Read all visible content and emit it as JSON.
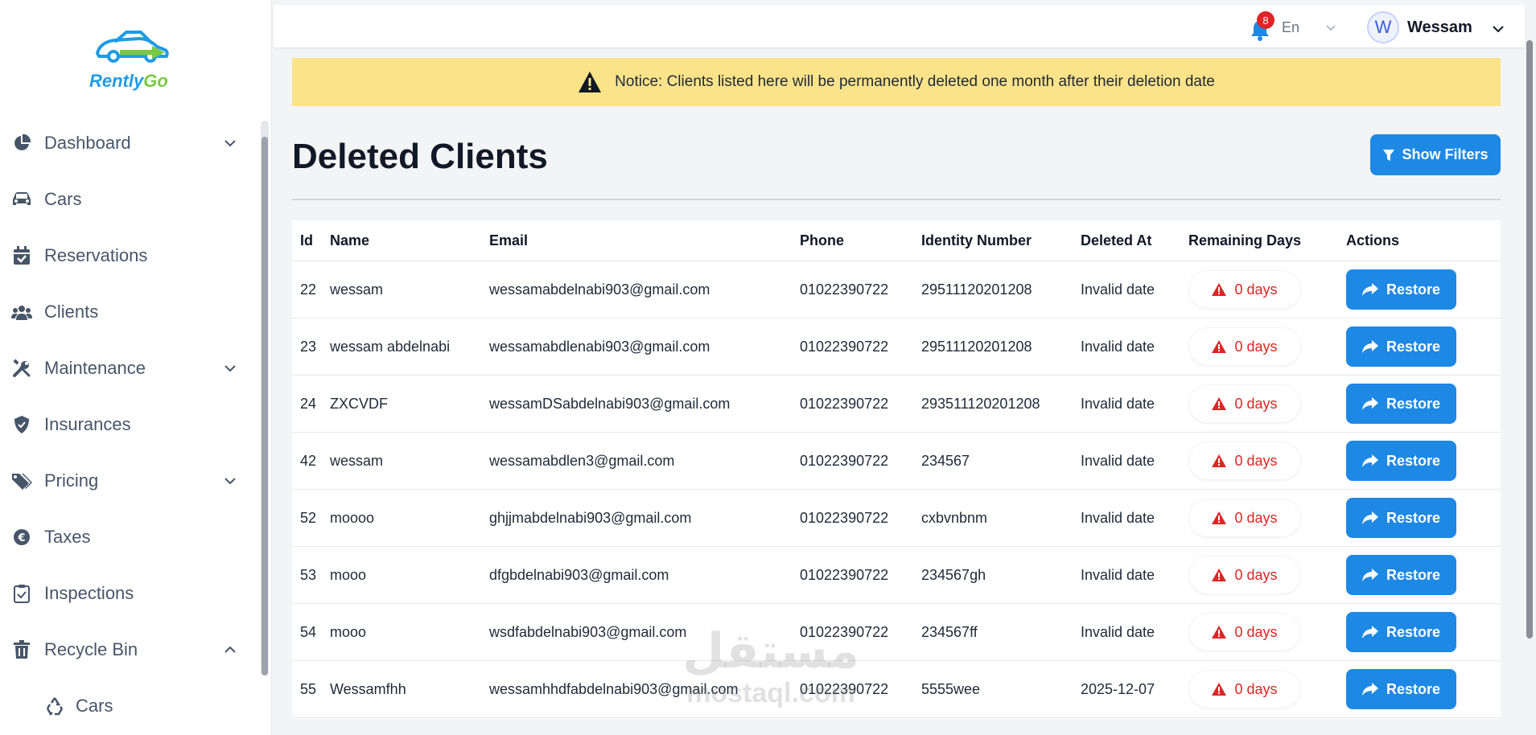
{
  "brand": {
    "name_part1": "Rently",
    "name_part2": "Go",
    "primary_color": "#1e88e5",
    "accent_color": "#7ac943"
  },
  "sidebar": {
    "items": [
      {
        "label": "Dashboard",
        "icon": "pie-chart-icon",
        "expandable": true
      },
      {
        "label": "Cars",
        "icon": "car-icon",
        "expandable": false
      },
      {
        "label": "Reservations",
        "icon": "calendar-check-icon",
        "expandable": false
      },
      {
        "label": "Clients",
        "icon": "users-icon",
        "expandable": false
      },
      {
        "label": "Maintenance",
        "icon": "tools-icon",
        "expandable": true
      },
      {
        "label": "Insurances",
        "icon": "shield-icon",
        "expandable": false
      },
      {
        "label": "Pricing",
        "icon": "tags-icon",
        "expandable": true
      },
      {
        "label": "Taxes",
        "icon": "euro-coin-icon",
        "expandable": false
      },
      {
        "label": "Inspections",
        "icon": "clipboard-check-icon",
        "expandable": false
      },
      {
        "label": "Recycle Bin",
        "icon": "trash-icon",
        "expandable": true,
        "expanded": true
      }
    ],
    "sub_items": [
      {
        "label": "Cars",
        "icon": "recycle-icon"
      }
    ]
  },
  "header": {
    "notification_count": "8",
    "language": "En",
    "user_initial": "W",
    "user_name": "Wessam"
  },
  "notice": {
    "text": "Notice: Clients listed here will be permanently deleted one month after their deletion date"
  },
  "page": {
    "title": "Deleted Clients",
    "filters_label": "Show Filters"
  },
  "table": {
    "columns": [
      "Id",
      "Name",
      "Email",
      "Phone",
      "Identity Number",
      "Deleted At",
      "Remaining Days",
      "Actions"
    ],
    "restore_label": "Restore",
    "rows": [
      {
        "id": "22",
        "name": "wessam",
        "email": "wessamabdelnabi903@gmail.com",
        "phone": "01022390722",
        "identity": "29511120201208",
        "deleted_at": "Invalid date",
        "remaining": "0 days"
      },
      {
        "id": "23",
        "name": "wessam abdelnabi",
        "email": "wessamabdlenabi903@gmail.com",
        "phone": "01022390722",
        "identity": "29511120201208",
        "deleted_at": "Invalid date",
        "remaining": "0 days"
      },
      {
        "id": "24",
        "name": "ZXCVDF",
        "email": "wessamDSabdelnabi903@gmail.com",
        "phone": "01022390722",
        "identity": "293511120201208",
        "deleted_at": "Invalid date",
        "remaining": "0 days"
      },
      {
        "id": "42",
        "name": "wessam",
        "email": "wessamabdlen3@gmail.com",
        "phone": "01022390722",
        "identity": "234567",
        "deleted_at": "Invalid date",
        "remaining": "0 days"
      },
      {
        "id": "52",
        "name": "moooo",
        "email": "ghjjmabdelnabi903@gmail.com",
        "phone": "01022390722",
        "identity": "cxbvnbnm",
        "deleted_at": "Invalid date",
        "remaining": "0 days"
      },
      {
        "id": "53",
        "name": "mooo",
        "email": "dfgbdelnabi903@gmail.com",
        "phone": "01022390722",
        "identity": "234567gh",
        "deleted_at": "Invalid date",
        "remaining": "0 days"
      },
      {
        "id": "54",
        "name": "mooo",
        "email": "wsdfabdelnabi903@gmail.com",
        "phone": "01022390722",
        "identity": "234567ff",
        "deleted_at": "Invalid date",
        "remaining": "0 days"
      },
      {
        "id": "55",
        "name": "Wessamfhh",
        "email": "wessamhhdfabdelnabi903@gmail.com",
        "phone": "01022390722",
        "identity": "5555wee",
        "deleted_at": "2025-12-07",
        "remaining": "0 days"
      }
    ]
  },
  "watermark": {
    "line1": "مستقل",
    "line2": "mostaql.com"
  }
}
